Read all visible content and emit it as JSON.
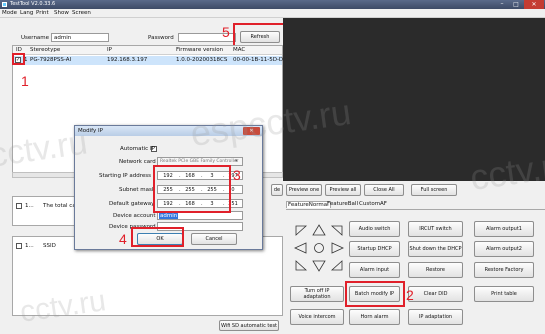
{
  "window": {
    "title": "TestTool V2.0.33.6",
    "menu": [
      "Mode",
      "Lang",
      "Print",
      "Show",
      "Screen"
    ]
  },
  "login": {
    "username_label": "Username",
    "username_value": "admin",
    "password_label": "Password",
    "password_value": "",
    "refresh_label": "Refresh"
  },
  "device_table": {
    "columns": [
      "ID",
      "Stereotype",
      "IP",
      "Firmware version",
      "MAC"
    ],
    "rows": [
      {
        "id": "1",
        "stereotype": "PG-7928PSS-AI",
        "ip": "192.168.3.197",
        "firmware": "1.0.0-20200318CS",
        "mac": "00-00-1B-11-5D-DD",
        "checked": true
      }
    ]
  },
  "modify_dialog": {
    "title": "Modify IP",
    "automatic_ip_label": "Automatic IP",
    "network_card_label": "Network card",
    "network_card_value": "Realtek PCIe GBE Family Controller",
    "starting_ip_label": "Starting IP address",
    "starting_ip": [
      "192",
      "168",
      "3",
      "197"
    ],
    "subnet_mask_label": "Subnet mask",
    "subnet_mask": [
      "255",
      "255",
      "255",
      "0"
    ],
    "gateway_label": "Default gateway",
    "gateway": [
      "192",
      "168",
      "3",
      "251"
    ],
    "device_account_label": "Device account",
    "device_account_value": "admin",
    "device_password_label": "Device password",
    "device_password_value": "",
    "ok_label": "OK",
    "cancel_label": "Cancel"
  },
  "left_panels": {
    "total_label": "The total capacity",
    "row_prefix": "1...",
    "ssid_label": "SSID",
    "wifi_test_label": "Wifi SD automatic test",
    "side_button": "de"
  },
  "preview_bar": {
    "preview_one": "Preview one",
    "preview_all": "Preview all",
    "close_all": "Close All",
    "full_screen": "Full screen"
  },
  "feature_tabs": [
    "FeatureNormal",
    "FeatureBall",
    "Custom",
    "AF"
  ],
  "feature_buttons": {
    "audio_switch": "Audio switch",
    "ircut_switch": "IRCUT switch",
    "alarm_output1": "Alarm output1",
    "startup_dhcp": "Startup DHCP",
    "shutdown_dhcp": "Shut down the DHCP",
    "alarm_output2": "Alarm output2",
    "alarm_input": "Alarm input",
    "restore": "Restore",
    "restore_factory": "Restore Factory",
    "turn_off_ip": "Turn off IP adaptation",
    "batch_modify_ip": "Batch modify IP",
    "clear_did": "Clear DID",
    "print_table": "Print table",
    "voice_intercom": "Voice intercom",
    "horn_alarm": "Horn alarm",
    "ip_adaptation": "IP adaptation"
  },
  "annotations": [
    "1",
    "2",
    "3",
    "4",
    "5"
  ],
  "watermark": "cctv.ru",
  "watermark_alt": "espcctv.ru",
  "colors": {
    "annotation": "#e0202a",
    "selected_row": "#cde4fb",
    "video_area": "#2b2b2b"
  }
}
